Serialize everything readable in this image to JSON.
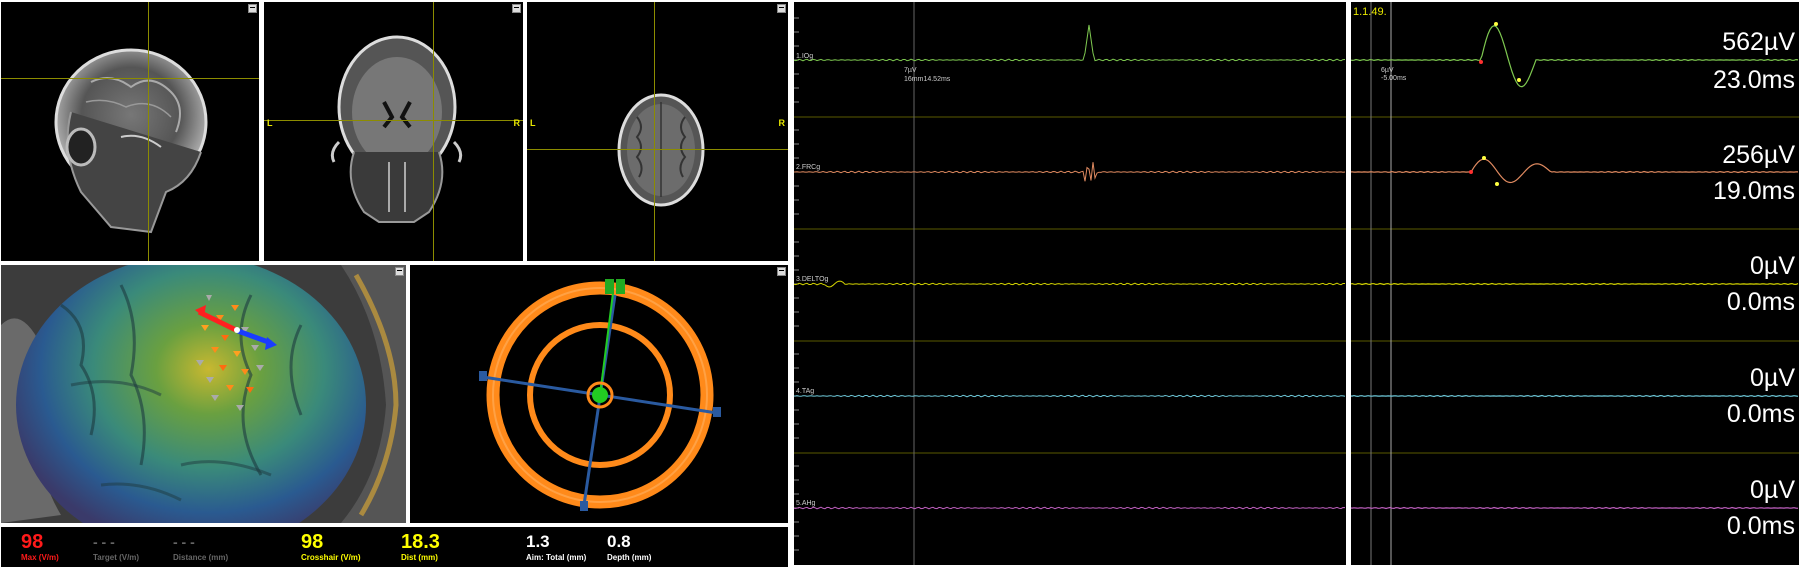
{
  "mri": {
    "sagittal": {
      "name": "sagittal"
    },
    "coronal": {
      "left": "L",
      "right": "R"
    },
    "axial": {
      "left": "L",
      "right": "R"
    }
  },
  "stats": [
    {
      "value": "98",
      "label": "Max (V/m)",
      "color": "#ff1a1a"
    },
    {
      "value": "- - -",
      "label": "Target (V/m)",
      "color": "#666666"
    },
    {
      "value": "- - -",
      "label": "Distance (mm)",
      "color": "#666666"
    },
    {
      "value": "98",
      "label": "Crosshair (V/m)",
      "color": "#ffff00"
    },
    {
      "value": "18.3",
      "label": "Dist (mm)",
      "color": "#ffff00"
    },
    {
      "value": "1.3",
      "label": "Aim: Total (mm)",
      "color": "#ffffff"
    },
    {
      "value": "0.8",
      "label": "Depth (mm)",
      "color": "#ffffff"
    }
  ],
  "emg": {
    "right_header": "1.1.49.",
    "cursor_left": {
      "line1": "7µV",
      "line2": "16mm14.52ms"
    },
    "cursor_right": {
      "line1": "6µV",
      "line2": "-5.00ms"
    },
    "channels": [
      {
        "label": "1.IOg",
        "color": "#7ec850",
        "amplitude": "562µV",
        "latency": "23.0ms"
      },
      {
        "label": "2.FRCg",
        "color": "#e08a60",
        "amplitude": "256µV",
        "latency": "19.0ms"
      },
      {
        "label": "3.DELTOg",
        "color": "#d4d400",
        "amplitude": "0µV",
        "latency": "0.0ms"
      },
      {
        "label": "4.TAg",
        "color": "#6ec8d8",
        "amplitude": "0µV",
        "latency": "0.0ms"
      },
      {
        "label": "5.AHg",
        "color": "#c060c0",
        "amplitude": "0µV",
        "latency": "0.0ms"
      }
    ]
  },
  "colors": {
    "ring": "#ff8a1a",
    "aim": "#22cc22",
    "crosshair": "#2a5aa0",
    "arrow_red": "#ff2020",
    "arrow_blue": "#1a3cff"
  }
}
